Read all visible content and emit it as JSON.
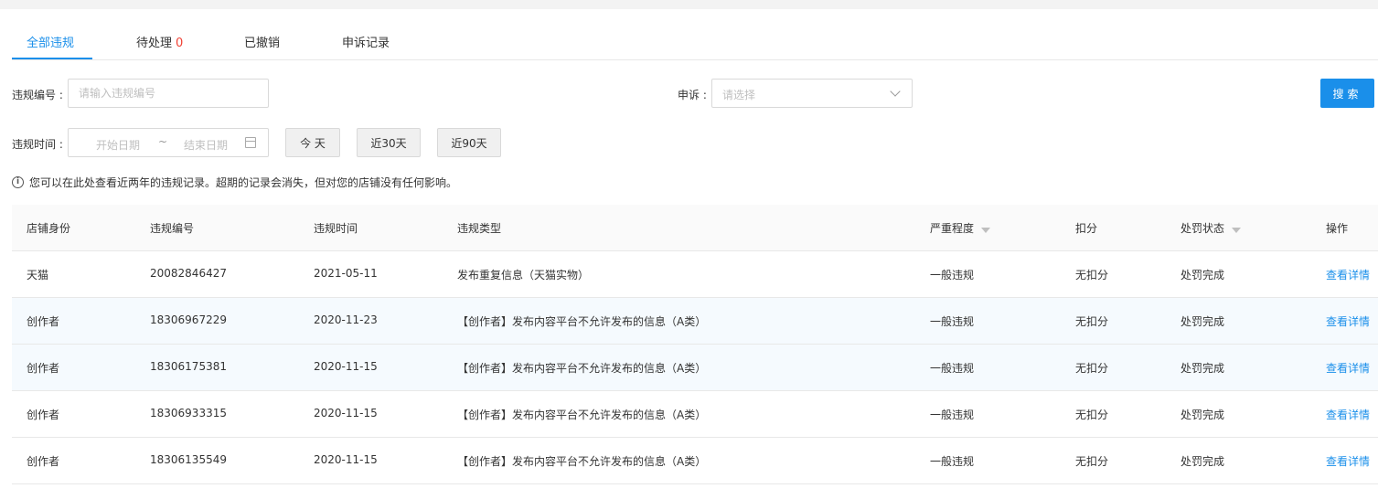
{
  "tabs": [
    {
      "label": "全部违规",
      "active": true
    },
    {
      "label": "待处理",
      "count": "0"
    },
    {
      "label": "已撤销"
    },
    {
      "label": "申诉记录"
    }
  ],
  "filters": {
    "id_label": "违规编号 :",
    "id_placeholder": "请输入违规编号",
    "appeal_label": "申诉 :",
    "appeal_placeholder": "请选择",
    "search_label": "搜索",
    "time_label": "违规时间 :",
    "start_placeholder": "开始日期",
    "separator": "~",
    "end_placeholder": "结束日期",
    "quick": [
      "今 天",
      "近30天",
      "近90天"
    ]
  },
  "notice": "您可以在此处查看近两年的违规记录。超期的记录会消失，但对您的店铺没有任何影响。",
  "table": {
    "headers": [
      "店铺身份",
      "违规编号",
      "违规时间",
      "违规类型",
      "严重程度",
      "扣分",
      "处罚状态",
      "操作"
    ],
    "rows": [
      [
        "天猫",
        "20082846427",
        "2021-05-11",
        "发布重复信息（天猫实物）",
        "一般违规",
        "无扣分",
        "处罚完成",
        "查看详情"
      ],
      [
        "创作者",
        "18306967229",
        "2020-11-23",
        "【创作者】发布内容平台不允许发布的信息（A类）",
        "一般违规",
        "无扣分",
        "处罚完成",
        "查看详情"
      ],
      [
        "创作者",
        "18306175381",
        "2020-11-15",
        "【创作者】发布内容平台不允许发布的信息（A类）",
        "一般违规",
        "无扣分",
        "处罚完成",
        "查看详情"
      ],
      [
        "创作者",
        "18306933315",
        "2020-11-15",
        "【创作者】发布内容平台不允许发布的信息（A类）",
        "一般违规",
        "无扣分",
        "处罚完成",
        "查看详情"
      ],
      [
        "创作者",
        "18306135549",
        "2020-11-15",
        "【创作者】发布内容平台不允许发布的信息（A类）",
        "一般违规",
        "无扣分",
        "处罚完成",
        "查看详情"
      ]
    ]
  },
  "colors": {
    "accent": "#1a8fea",
    "count": "#f04134"
  }
}
